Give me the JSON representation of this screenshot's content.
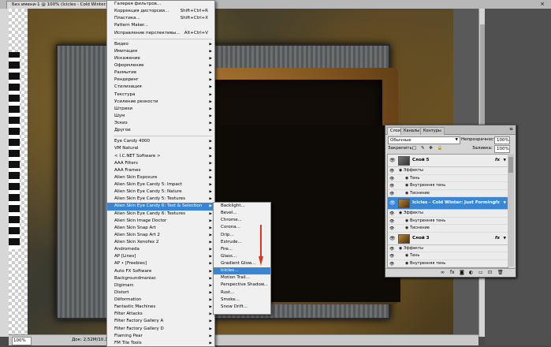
{
  "document": {
    "tab_title": "Без имени-1 @ 100% (Icicles - Cold Winter: J",
    "close_glyph": "×",
    "zoom_value": "100%",
    "doc_info": "Док: 2,52M/10,1M"
  },
  "filter_menu": {
    "top_items": [
      {
        "label": "Галерея фильтров...",
        "shortcut": "",
        "arrow": false
      },
      {
        "label": "Коррекция дисторсии...",
        "shortcut": "Shift+Ctrl+R",
        "arrow": false
      },
      {
        "label": "Пластика...",
        "shortcut": "Shift+Ctrl+X",
        "arrow": false
      },
      {
        "label": "Pattern Maker...",
        "shortcut": "",
        "arrow": false
      },
      {
        "label": "Исправление перспективы...",
        "shortcut": "Alt+Ctrl+V",
        "arrow": false
      }
    ],
    "group_items": [
      {
        "label": "Видео",
        "arrow": true
      },
      {
        "label": "Имитация",
        "arrow": true
      },
      {
        "label": "Искажение",
        "arrow": true
      },
      {
        "label": "Оформление",
        "arrow": true
      },
      {
        "label": "Размытие",
        "arrow": true
      },
      {
        "label": "Рендеринг",
        "arrow": true
      },
      {
        "label": "Стилизация",
        "arrow": true
      },
      {
        "label": "Текстура",
        "arrow": true
      },
      {
        "label": "Усиление резкости",
        "arrow": true
      },
      {
        "label": "Штрихи",
        "arrow": true
      },
      {
        "label": "Шум",
        "arrow": true
      },
      {
        "label": "Эскиз",
        "arrow": true
      },
      {
        "label": "Другое",
        "arrow": true
      }
    ],
    "plugin_items": [
      {
        "label": "Eye Candy 4000",
        "arrow": true
      },
      {
        "label": "VM Natural",
        "arrow": true
      },
      {
        "label": "< I.C.NET Software >",
        "arrow": true
      },
      {
        "label": "AAA Filters",
        "arrow": true
      },
      {
        "label": "AAA Frames",
        "arrow": true
      },
      {
        "label": "Alien Skin Exposure",
        "arrow": true
      },
      {
        "label": "Alien Skin Eye Candy 5: Impact",
        "arrow": true
      },
      {
        "label": "Alien Skin Eye Candy 5: Nature",
        "arrow": true
      },
      {
        "label": "Alien Skin Eye Candy 5: Textures",
        "arrow": true
      },
      {
        "label": "Alien Skin Eye Candy 6: Text & Selection",
        "arrow": true,
        "highlighted": true
      },
      {
        "label": "Alien Skin Eye Candy 6: Textures",
        "arrow": true
      },
      {
        "label": "Alien Skin Image Doctor",
        "arrow": true
      },
      {
        "label": "Alien Skin Snap Art",
        "arrow": true
      },
      {
        "label": "Alien Skin Snap Art 2",
        "arrow": true
      },
      {
        "label": "Alien Skin Xenofex 2",
        "arrow": true
      },
      {
        "label": "Andromeda",
        "arrow": true
      },
      {
        "label": "AP [Lines]",
        "arrow": true
      },
      {
        "label": "AP • [Freebies]",
        "arrow": true
      },
      {
        "label": "Auto FX Software",
        "arrow": true
      },
      {
        "label": "Backgroundmaniac",
        "arrow": true
      },
      {
        "label": "Digimarc",
        "arrow": true
      },
      {
        "label": "Distort",
        "arrow": true
      },
      {
        "label": "Dëformation",
        "arrow": true
      },
      {
        "label": "Fantastic Machines",
        "arrow": true
      },
      {
        "label": "Filter Attacks",
        "arrow": true
      },
      {
        "label": "Filter Factory Gallery A",
        "arrow": true
      },
      {
        "label": "Filter Factory Gallery D",
        "arrow": true
      },
      {
        "label": "Flaming Pear",
        "arrow": true
      },
      {
        "label": "FM Tile Tools",
        "arrow": true
      }
    ]
  },
  "submenu": {
    "items": [
      {
        "label": "Backlight..."
      },
      {
        "label": "Bevel..."
      },
      {
        "label": "Chrome..."
      },
      {
        "label": "Corona..."
      },
      {
        "label": "Drip..."
      },
      {
        "label": "Extrude..."
      },
      {
        "label": "Fire..."
      },
      {
        "label": "Glass..."
      },
      {
        "label": "Gradient Glow..."
      },
      {
        "label": "Icicles...",
        "highlighted": true
      },
      {
        "label": "Motion Trail..."
      },
      {
        "label": "Perspective Shadow..."
      },
      {
        "label": "Rust..."
      },
      {
        "label": "Smoke..."
      },
      {
        "label": "Snow Drift..."
      }
    ]
  },
  "layers_panel": {
    "tabs": [
      "Слои",
      "Каналы",
      "Контуры"
    ],
    "active_tab": "Слои",
    "blend_mode": "Обычные",
    "opacity_label": "Непрозрачность:",
    "opacity_value": "100%",
    "lock_label": "Закрепить:",
    "fill_label": "Заливка:",
    "fill_value": "100%",
    "eye_glyph": "👁",
    "fx_label": "fx",
    "layers": [
      {
        "name": "Слой 5",
        "selected": false,
        "thumb": "grey",
        "effects_title": "Эффекты",
        "effects": [
          "Тень",
          "Внутренняя тень",
          "Тиснение"
        ]
      },
      {
        "name": "Icicles - Cold Winter: Just Forming",
        "selected": true,
        "thumb": "rust",
        "effects_title": "Эффекты",
        "effects": [
          "Внутренняя тень",
          "Тиснение"
        ]
      },
      {
        "name": "Слой 3",
        "selected": false,
        "thumb": "rust",
        "effects_title": "Эффекты",
        "effects": [
          "Тень",
          "Внутренняя тень"
        ]
      }
    ],
    "bottom_icons": [
      "link-icon",
      "fx-icon",
      "mask-icon",
      "adjustment-icon",
      "folder-icon",
      "new-layer-icon",
      "trash-icon"
    ]
  },
  "colors": {
    "highlight": "#3a86d4",
    "arrow": "#e03020"
  }
}
